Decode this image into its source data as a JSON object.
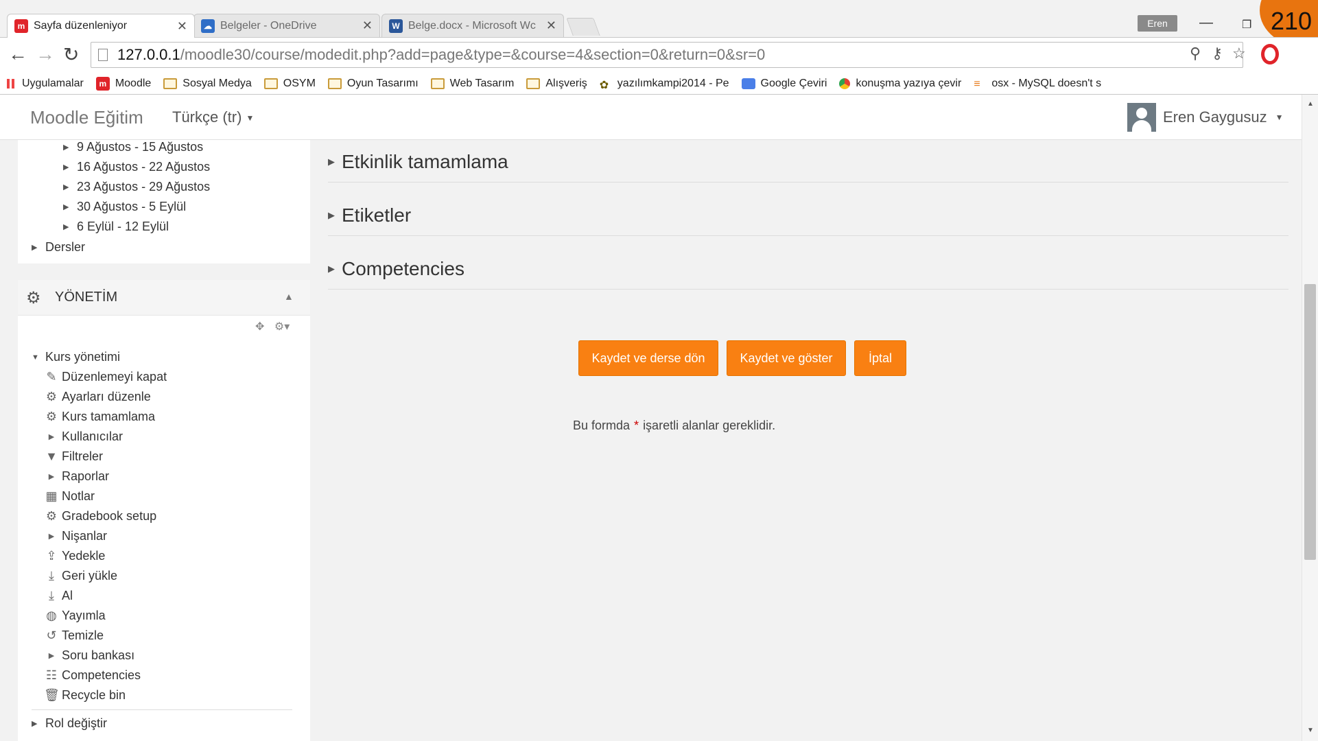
{
  "browser": {
    "tabs": [
      {
        "title": "Sayfa düzenleniyor",
        "favicon": "moodle-icon",
        "active": true
      },
      {
        "title": "Belgeler - OneDrive",
        "favicon": "onedrive-icon",
        "active": false
      },
      {
        "title": "Belge.docx - Microsoft Wc",
        "favicon": "word-icon",
        "active": false
      }
    ],
    "profile_name": "Eren",
    "counter": "210",
    "url_host": "127.0.0.1",
    "url_path": "/moodle30/course/modedit.php?add=page&type=&course=4&section=0&return=0&sr=0",
    "bookmarks": [
      {
        "label": "Uygulamalar",
        "icon": "apps-icon"
      },
      {
        "label": "Moodle",
        "icon": "moodle-icon"
      },
      {
        "label": "Sosyal Medya",
        "icon": "folder-icon"
      },
      {
        "label": "OSYM",
        "icon": "folder-icon"
      },
      {
        "label": "Oyun Tasarımı",
        "icon": "folder-icon"
      },
      {
        "label": "Web Tasarım",
        "icon": "folder-icon"
      },
      {
        "label": "Alışveriş",
        "icon": "folder-icon"
      },
      {
        "label": "yazılımkampi2014 - Pe",
        "icon": "bee-icon"
      },
      {
        "label": "Google Çeviri",
        "icon": "google-translate-icon"
      },
      {
        "label": "konuşma yazıya çevir",
        "icon": "chrome-icon"
      },
      {
        "label": "osx - MySQL doesn't s",
        "icon": "stackoverflow-icon"
      }
    ]
  },
  "navbar": {
    "brand": "Moodle Eğitim",
    "language": "Türkçe (tr)",
    "user_name": "Eren Gaygusuz"
  },
  "nav_block": {
    "weeks": [
      "9 Ağustos - 15 Ağustos",
      "16 Ağustos - 22 Ağustos",
      "23 Ağustos - 29 Ağustos",
      "30 Ağustos - 5 Eylül",
      "6 Eylül - 12 Eylül"
    ],
    "courses_label": "Dersler"
  },
  "admin_block": {
    "title": "YÖNETİM",
    "course_admin_label": "Kurs yönetimi",
    "items": [
      {
        "label": "Düzenlemeyi kapat",
        "icon": "pencil-icon"
      },
      {
        "label": "Ayarları düzenle",
        "icon": "gear-icon"
      },
      {
        "label": "Kurs tamamlama",
        "icon": "gear-icon"
      },
      {
        "label": "Kullanıcılar",
        "icon": "triangle-right-icon"
      },
      {
        "label": "Filtreler",
        "icon": "filter-icon"
      },
      {
        "label": "Raporlar",
        "icon": "triangle-right-icon"
      },
      {
        "label": "Notlar",
        "icon": "table-icon"
      },
      {
        "label": "Gradebook setup",
        "icon": "gear-icon"
      },
      {
        "label": "Nişanlar",
        "icon": "triangle-right-icon"
      },
      {
        "label": "Yedekle",
        "icon": "upload-icon"
      },
      {
        "label": "Geri yükle",
        "icon": "download-icon"
      },
      {
        "label": "Al",
        "icon": "download-icon"
      },
      {
        "label": "Yayımla",
        "icon": "globe-icon"
      },
      {
        "label": "Temizle",
        "icon": "refresh-icon"
      },
      {
        "label": "Soru bankası",
        "icon": "triangle-right-icon"
      },
      {
        "label": "Competencies",
        "icon": "competencies-icon"
      },
      {
        "label": "Recycle bin",
        "icon": "trash-icon"
      }
    ],
    "role_switch_label": "Rol değiştir"
  },
  "main": {
    "sections": [
      "Etkinlik tamamlama",
      "Etiketler",
      "Competencies"
    ],
    "buttons": {
      "save_return": "Kaydet ve derse dön",
      "save_display": "Kaydet ve göster",
      "cancel": "İptal"
    },
    "required_note": {
      "before": "Bu formda",
      "star": "*",
      "after": "işaretli alanlar gereklidir."
    }
  },
  "colors": {
    "accent": "#f98012",
    "moodle_red": "#e0242a",
    "counter_orange": "#e8740f"
  }
}
